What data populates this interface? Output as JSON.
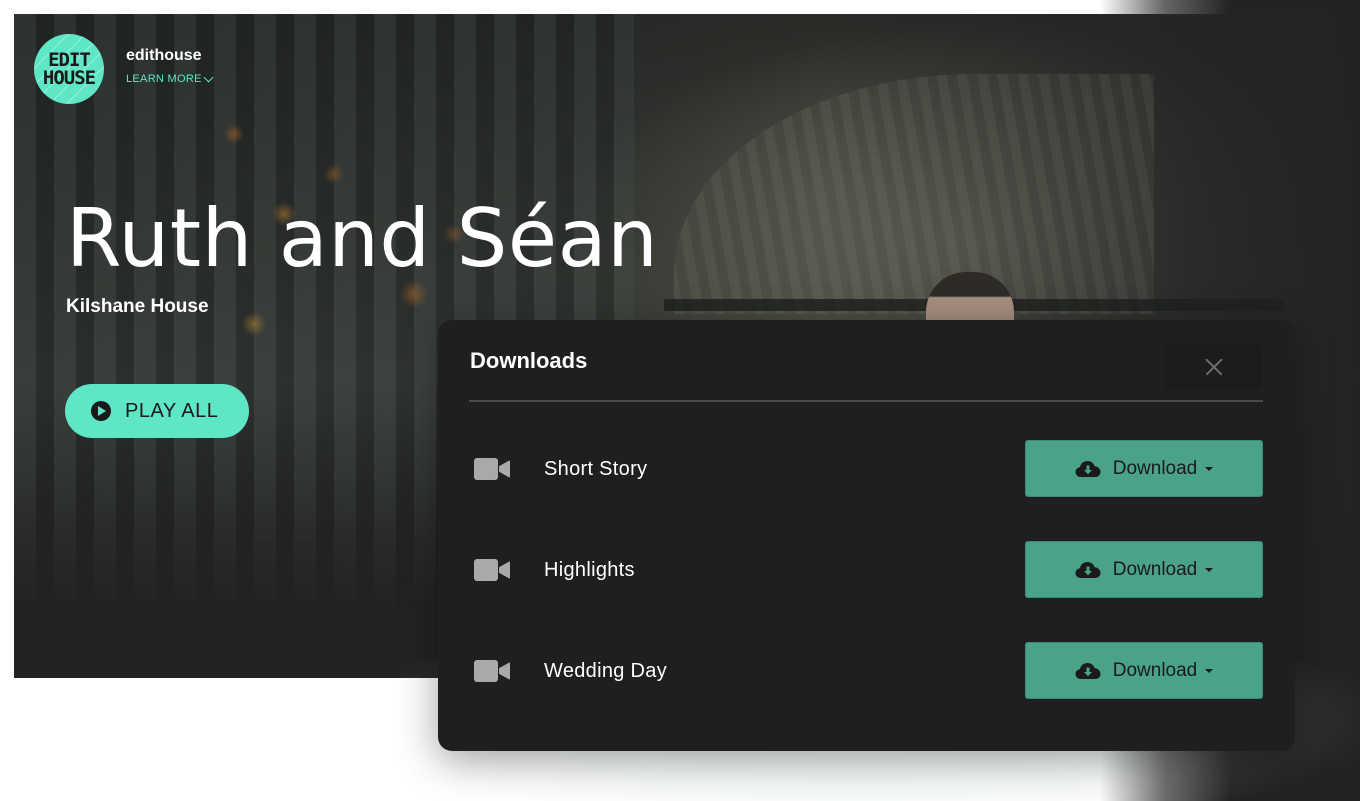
{
  "brand": {
    "logo_line1": "EDIT",
    "logo_line2": "HOUSE",
    "name": "edithouse",
    "learn_more": "LEARN MORE"
  },
  "hero": {
    "title": "Ruth and Séan",
    "subtitle": "Kilshane House",
    "play_all_label": "PLAY ALL"
  },
  "modal": {
    "title": "Downloads",
    "close_icon": "close-icon",
    "items": [
      {
        "label": "Short Story",
        "icon": "video-camera-icon",
        "button_label": "Download"
      },
      {
        "label": "Highlights",
        "icon": "video-camera-icon",
        "button_label": "Download"
      },
      {
        "label": "Wedding Day",
        "icon": "video-camera-icon",
        "button_label": "Download"
      }
    ]
  },
  "colors": {
    "accent": "#5ee6c6",
    "download_button": "#4ba28b",
    "modal_background": "#1f1f21"
  }
}
